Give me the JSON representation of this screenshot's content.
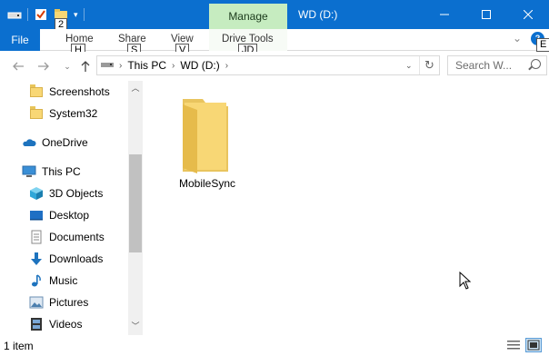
{
  "window": {
    "title": "WD (D:)",
    "contextual_tab": "Manage",
    "qat_badge": "2"
  },
  "ribbon": {
    "file": "File",
    "tabs": [
      {
        "label": "Home",
        "keytip": "H"
      },
      {
        "label": "Share",
        "keytip": "S"
      },
      {
        "label": "View",
        "keytip": "V"
      },
      {
        "label": "Drive Tools",
        "keytip": "JD"
      }
    ],
    "help_keytip": "E"
  },
  "address": {
    "crumbs": [
      "This PC",
      "WD (D:)"
    ],
    "search_placeholder": "Search W..."
  },
  "nav_pane": {
    "items": [
      {
        "label": "Screenshots",
        "icon": "folder-icon"
      },
      {
        "label": "System32",
        "icon": "folder-icon"
      },
      {
        "label": "OneDrive",
        "icon": "cloud-icon"
      },
      {
        "label": "This PC",
        "icon": "computer-icon"
      },
      {
        "label": "3D Objects",
        "icon": "cube-icon"
      },
      {
        "label": "Desktop",
        "icon": "desktop-icon"
      },
      {
        "label": "Documents",
        "icon": "document-icon"
      },
      {
        "label": "Downloads",
        "icon": "download-arrow-icon"
      },
      {
        "label": "Music",
        "icon": "music-note-icon"
      },
      {
        "label": "Pictures",
        "icon": "pictures-icon"
      },
      {
        "label": "Videos",
        "icon": "film-icon"
      }
    ]
  },
  "content": {
    "items": [
      {
        "label": "MobileSync",
        "icon": "folder-icon"
      }
    ]
  },
  "status": {
    "item_count": "1 item"
  },
  "colors": {
    "accent": "#0b6fcf",
    "manage_tab": "#c6ecc0",
    "folder": "#f8d775"
  }
}
